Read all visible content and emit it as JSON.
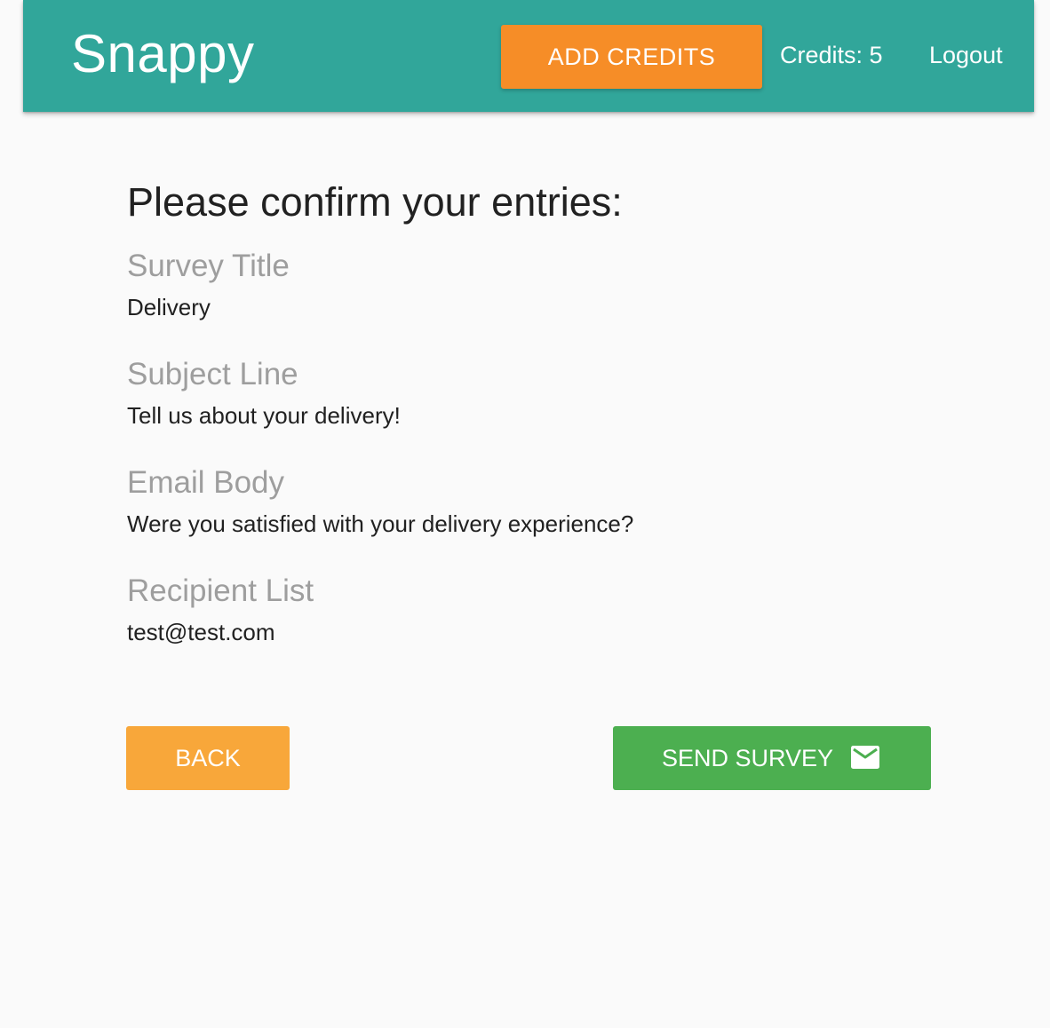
{
  "navbar": {
    "brand": "Snappy",
    "add_credits_label": "ADD CREDITS",
    "credits_text": "Credits: 5",
    "logout_label": "Logout"
  },
  "colors": {
    "navbar_bg": "#31a69a",
    "add_credits_bg": "#f68d27",
    "back_bg": "#f8a73a",
    "send_bg": "#4caf50"
  },
  "review": {
    "heading": "Please confirm your entries:",
    "fields": [
      {
        "label": "Survey Title",
        "value": "Delivery"
      },
      {
        "label": "Subject Line",
        "value": "Tell us about your delivery!"
      },
      {
        "label": "Email Body",
        "value": "Were you satisfied with your delivery experience?"
      },
      {
        "label": "Recipient List",
        "value": "test@test.com"
      }
    ]
  },
  "actions": {
    "back_label": "BACK",
    "send_label": "SEND SURVEY",
    "send_icon": "email-icon"
  }
}
